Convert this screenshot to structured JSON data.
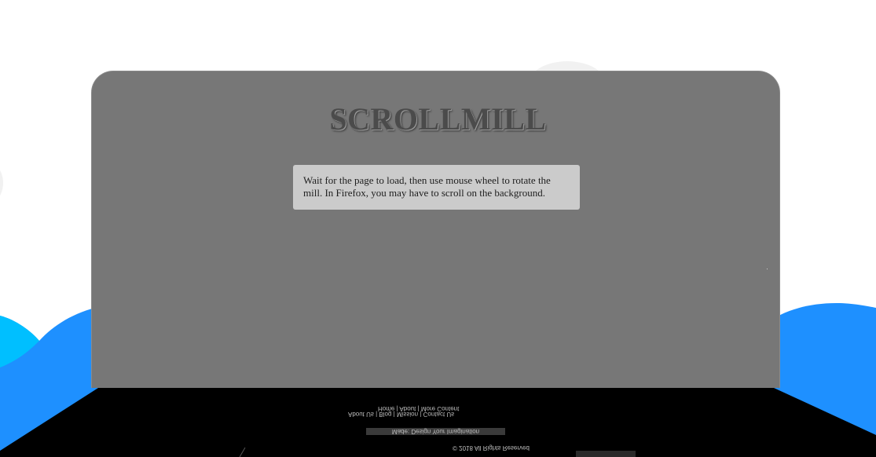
{
  "page": {
    "title": "SCROLLMILL",
    "instructions": "Wait for the page to load, then use mouse wheel to rotate the mill. In Firefox, you may have to scroll on the background."
  },
  "colors": {
    "panel": "#777777",
    "info_box": "#cbcbcb",
    "wave_blue": "#1e90ff",
    "wave_cyan": "#00bfff",
    "floor": "#000000"
  },
  "floor_reflection": {
    "line1": "Home | About | More Content",
    "line2": "About Us | Blog | Mission | Contact Us",
    "bar_label": "Made: Design Your Imagination",
    "line3": "© 2018 All Rights Reserved"
  }
}
